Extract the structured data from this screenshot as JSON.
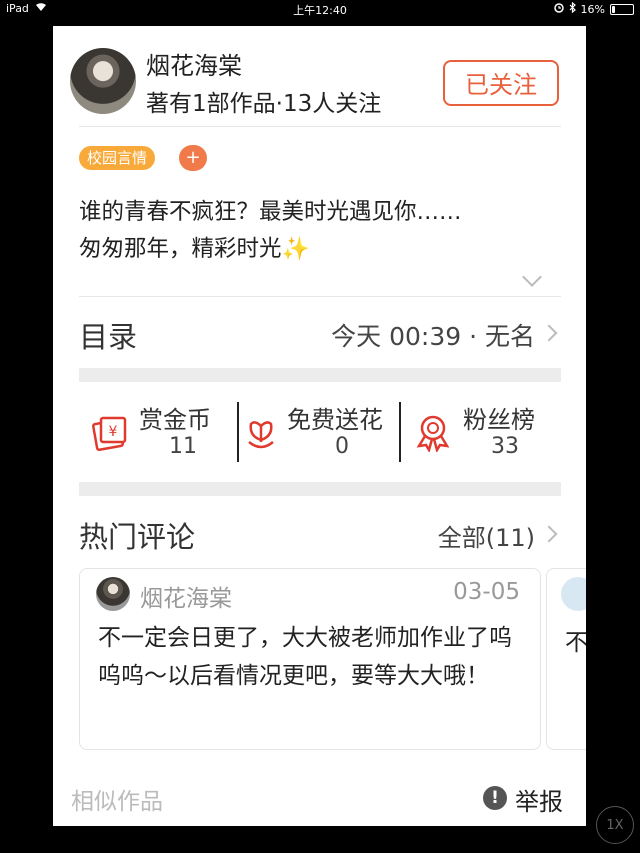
{
  "status_bar": {
    "device": "iPad",
    "time": "上午12:40",
    "battery": "16%",
    "battery_level": 0.16
  },
  "author": {
    "name": "烟花海棠",
    "meta": "著有1部作品·13人关注",
    "follow_label": "已关注"
  },
  "tags": {
    "primary": "校园言情",
    "add": "+"
  },
  "intro": {
    "line1": "谁的青春不疯狂？最美时光遇见你……",
    "line2": "匆匆那年，精彩时光",
    "emoji": "✨"
  },
  "toc": {
    "label": "目录",
    "value": "今天 00:39 · 无名"
  },
  "stats": [
    {
      "label": "赏金币",
      "value": "11",
      "icon": "red-envelope-icon"
    },
    {
      "label": "免费送花",
      "value": "0",
      "icon": "flower-icon"
    },
    {
      "label": "粉丝榜",
      "value": "33",
      "icon": "medal-icon"
    }
  ],
  "hot_comments": {
    "label": "热门评论",
    "all": "全部(11)"
  },
  "comment": {
    "name": "烟花海棠",
    "date": "03-05",
    "text": "不一定会日更了，大大被老师加作业了呜呜呜～以后看情况更吧，要等大大哦！"
  },
  "comment2_preview": "不",
  "footer": {
    "similar": "相似作品",
    "report_icon": "!",
    "report": "举报"
  },
  "speed_button": "1X",
  "colors": {
    "accent": "#e8603c",
    "tag": "#f7a93a",
    "icon_red": "#e03a2e"
  }
}
